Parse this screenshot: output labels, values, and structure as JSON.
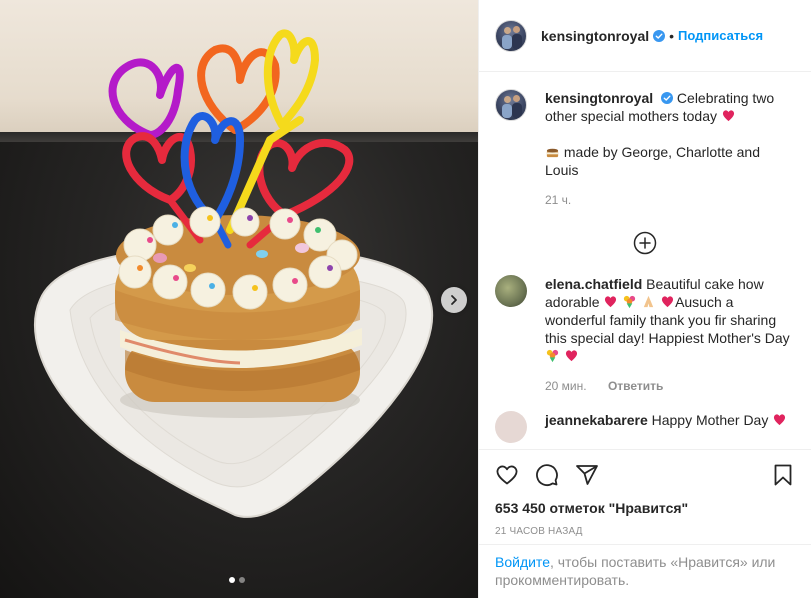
{
  "header": {
    "username": "kensingtonroyal",
    "separator": "•",
    "follow_label": "Подписаться"
  },
  "caption": {
    "username": "kensingtonroyal",
    "text": "Celebrating two other special mothers today",
    "line2": "made by George, Charlotte and Louis",
    "time": "21 ч."
  },
  "comments": [
    {
      "username": "elena.chatfield",
      "text_a": "Beautiful cake how adorable",
      "text_b": "Ausuch a wonderful family thank you fir sharing this special day! Happiest Mother's Day",
      "time": "20 мин.",
      "reply_label": "Ответить"
    },
    {
      "username": "jeannekabarere",
      "text": "Happy Mother Day"
    }
  ],
  "actions": {
    "likes": "653 450 отметок \"Нравится\"",
    "timestamp": "21 часов назад"
  },
  "login": {
    "link": "Войдите",
    "rest": ", чтобы поставить «Нравится» или прокомментировать."
  },
  "carousel": {
    "slides": 2,
    "active": 1
  },
  "icons": {
    "verified": "verified-badge-icon",
    "add": "plus-circle-icon",
    "like": "heart-outline-icon",
    "comment": "comment-bubble-icon",
    "share": "paper-plane-icon",
    "save": "bookmark-icon",
    "next": "chevron-right-icon"
  },
  "colors": {
    "accent": "#0095f6",
    "verified": "#3897f0",
    "text": "#262626",
    "muted": "#8e8e8e",
    "heart_red": "#ed4956"
  }
}
